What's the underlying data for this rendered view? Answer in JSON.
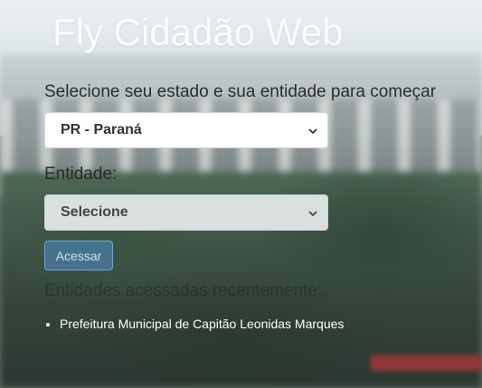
{
  "header": {
    "title": "Fly Cidadão Web"
  },
  "form": {
    "prompt": "Selecione seu estado e sua entidade para começar",
    "state_select": {
      "value": "PR - Paraná"
    },
    "entity_label": "Entidade:",
    "entity_select": {
      "value": "Selecione"
    },
    "access_button_label": "Acessar"
  },
  "recent": {
    "heading": "Entidades acessadas recentemente:",
    "items": [
      "Prefeitura Municipal de Capitão Leonidas Marques"
    ]
  },
  "colors": {
    "primary_button": "#508cc8",
    "text_dark": "#2c2c2c",
    "text_light": "#ffffff"
  },
  "icons": {
    "select_arrow": "chevron-down-icon"
  }
}
